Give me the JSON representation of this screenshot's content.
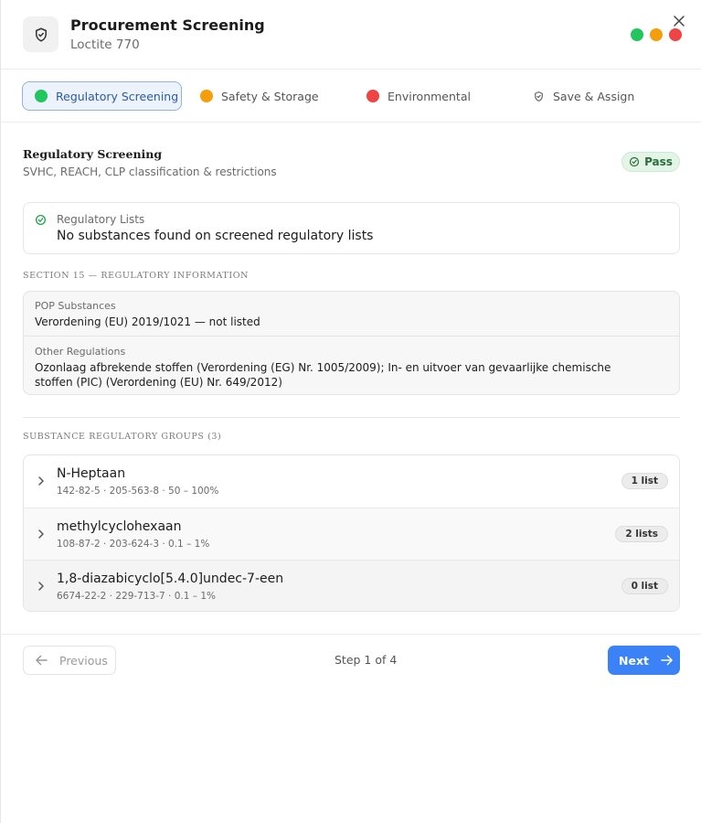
{
  "header": {
    "title": "Procurement Screening",
    "subtitle": "Loctite 770",
    "status_dots": [
      {
        "name": "green",
        "color": "#22c55e"
      },
      {
        "name": "orange",
        "color": "#f59e0b"
      },
      {
        "name": "red",
        "color": "#ef4444"
      }
    ]
  },
  "steps": [
    {
      "label": "Regulatory Screening",
      "status_color": "#22c55e",
      "active": true
    },
    {
      "label": "Safety & Storage",
      "status_color": "#f59e0b",
      "active": false
    },
    {
      "label": "Environmental",
      "status_color": "#ef4444",
      "active": false
    },
    {
      "label": "Save & Assign",
      "icon": "shield-check-icon",
      "active": false
    }
  ],
  "section": {
    "title": "Regulatory Screening",
    "subtitle": "SVHC, REACH, CLP classification & restrictions",
    "badge": "Pass"
  },
  "regulatory_lists": {
    "label": "Regulatory Lists",
    "value": "No substances found on screened regulatory lists"
  },
  "section15": {
    "heading": "SECTION 15 — REGULATORY INFORMATION",
    "rows": [
      {
        "label": "POP Substances",
        "value": "Verordening (EU) 2019/1021 — not listed"
      },
      {
        "label": "Other Regulations",
        "value": "Ozonlaag afbrekende stoffen (Verordening (EG) Nr. 1005/2009); In- en uitvoer van gevaarlijke chemische stoffen (PIC) (Verordening (EU) Nr. 649/2012)"
      }
    ]
  },
  "groups": {
    "heading": "SUBSTANCE REGULATORY GROUPS (3)",
    "items": [
      {
        "name": "N-Heptaan",
        "meta": "142-82-5 · 205-563-8 · 50 – 100%",
        "badge": "1 list"
      },
      {
        "name": "methylcyclohexaan",
        "meta": "108-87-2 · 203-624-3 · 0.1 – 1%",
        "badge": "2 lists"
      },
      {
        "name": "1,8-diazabicyclo[5.4.0]undec-7-een",
        "meta": "6674-22-2 · 229-713-7 · 0.1 – 1%",
        "badge": "0 list"
      }
    ]
  },
  "footer": {
    "previous_label": "Previous",
    "step_text": "Step 1 of 4",
    "next_label": "Next"
  }
}
